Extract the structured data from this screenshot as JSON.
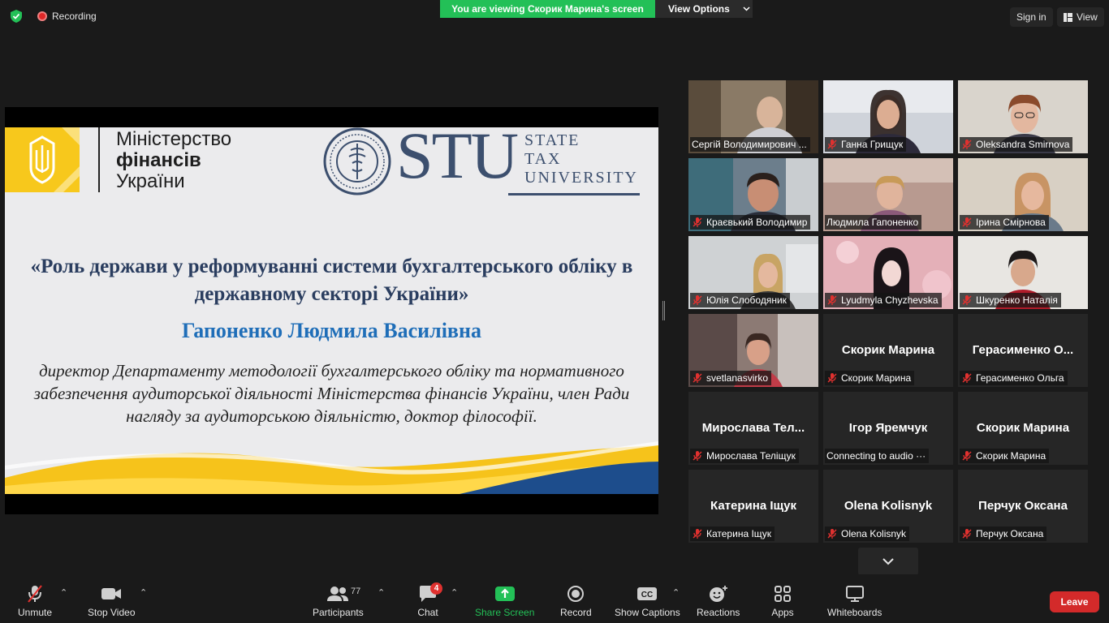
{
  "topbar": {
    "recording_label": "Recording",
    "viewing_banner": "You are viewing Скорик Марина's screen",
    "view_options_label": "View Options",
    "sign_in_label": "Sign in",
    "view_label": "View"
  },
  "slide": {
    "ministry_line1": "Міністерство",
    "ministry_line2": "фінансів",
    "ministry_line3": "України",
    "stu_big": "STU",
    "stu_line1": "STATE",
    "stu_line2": "TAX",
    "stu_line3": "UNIVERSITY",
    "title": "«Роль держави у реформуванні системи бухгалтерського обліку в державному секторі України»",
    "speaker": "Гапоненко Людмила Василівна",
    "description": "директор Департаменту методології бухгалтерського обліку та нормативного забезпечення аудиторської діяльності Міністерства фінансів України, член Ради нагляду за аудиторською діяльністю, доктор філософії."
  },
  "participants": [
    {
      "caption": "Сергій Володимирович ...",
      "muted": false
    },
    {
      "caption": "Ганна Грищук",
      "muted": true
    },
    {
      "caption": "Oleksandra Smirnova",
      "muted": true
    },
    {
      "caption": "Краєвький Володимир",
      "muted": true
    },
    {
      "caption": "Людмила Гапоненко",
      "muted": false
    },
    {
      "caption": "Ірина Смірнова",
      "muted": true
    },
    {
      "caption": "Юлія Слободяник",
      "muted": true
    },
    {
      "caption": "Lyudmyla Chyzhevska",
      "muted": true
    },
    {
      "caption": "Шкуренко Наталія",
      "muted": true
    },
    {
      "caption": "svetlanasvirko",
      "muted": true
    },
    {
      "name": "Скорик Марина",
      "caption": "Скорик Марина",
      "muted": true
    },
    {
      "name": "Герасименко О...",
      "caption": "Герасименко Ольга",
      "muted": true
    },
    {
      "name": "Мирослава Тел...",
      "caption": "Мирослава Теліщук",
      "muted": true
    },
    {
      "name": "Ігор Яремчук",
      "caption": "Connecting to audio ···",
      "muted": false
    },
    {
      "name": "Скорик Марина",
      "caption": "Скорик Марина",
      "muted": true
    },
    {
      "name": "Катерина Іщук",
      "caption": "Катерина Іщук",
      "muted": true
    },
    {
      "name": "Olena Kolisnyk",
      "caption": "Olena Kolisnyk",
      "muted": true
    },
    {
      "name": "Перчук Оксана",
      "caption": "Перчук Оксана",
      "muted": true
    }
  ],
  "toolbar": {
    "unmute": "Unmute",
    "stop_video": "Stop Video",
    "participants": "Participants",
    "participants_count": "77",
    "chat": "Chat",
    "chat_badge": "4",
    "share_screen": "Share Screen",
    "record": "Record",
    "show_captions": "Show Captions",
    "reactions": "Reactions",
    "apps": "Apps",
    "whiteboards": "Whiteboards",
    "leave": "Leave"
  },
  "colors": {
    "banner_green": "#23c057",
    "leave_red": "#d32a2a",
    "active_speaker": "#f3e36b",
    "slide_title": "#2a3d5f",
    "slide_name": "#1f6eb8"
  }
}
